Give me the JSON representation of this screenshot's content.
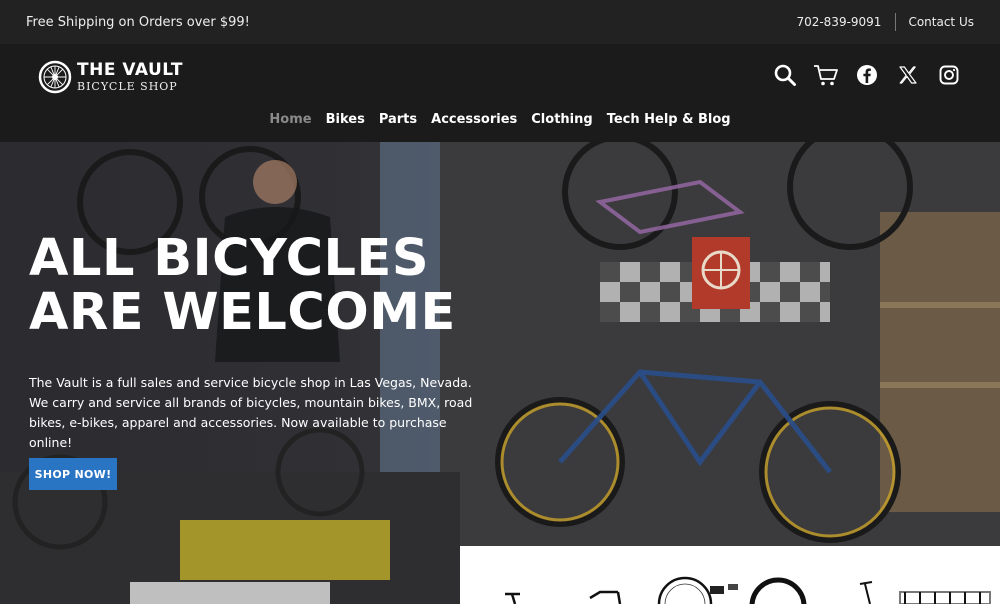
{
  "topbar": {
    "shipping_text": "Free Shipping on Orders over $99!",
    "phone": "702-839-9091",
    "contact_label": "Contact Us"
  },
  "logo": {
    "line1": "THE VAULT",
    "line2": "BICYCLE SHOP"
  },
  "header_icons": [
    "search-icon",
    "cart-icon",
    "facebook-icon",
    "x-twitter-icon",
    "instagram-icon"
  ],
  "nav": {
    "items": [
      {
        "label": "Home",
        "active": true
      },
      {
        "label": "Bikes"
      },
      {
        "label": "Parts"
      },
      {
        "label": "Accessories"
      },
      {
        "label": "Clothing"
      },
      {
        "label": "Tech Help & Blog"
      }
    ]
  },
  "hero": {
    "title_line1": "ALL BICYCLES",
    "title_line2": "ARE WELCOME",
    "description": "The Vault is a full sales and service bicycle shop in Las Vegas, Nevada. We carry and service all brands of bicycles, mountain bikes, BMX, road bikes, e-bikes, apparel and accessories. Now available to purchase online!",
    "cta_label": "SHOP NOW!"
  },
  "colors": {
    "cta": "#2a74c4",
    "topbar_bg": "#222222",
    "header_bg": "#1b1b1b",
    "nav_active": "#8a8a8a"
  }
}
